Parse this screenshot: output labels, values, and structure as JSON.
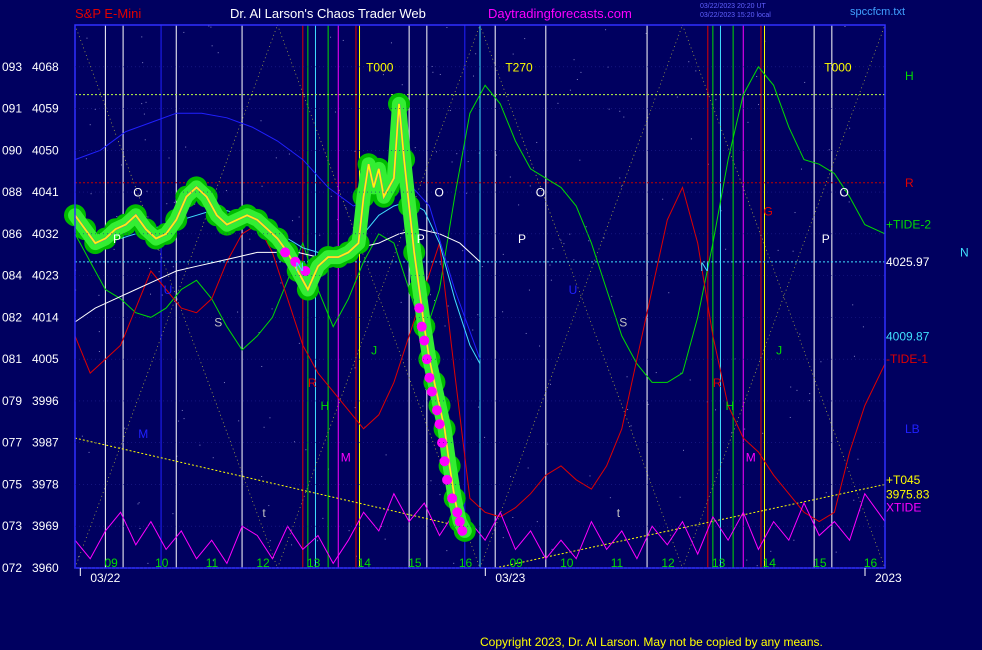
{
  "header": {
    "title_left": "S&P E-Mini",
    "title_center": "Dr. Al Larson's Chaos Trader Web",
    "site": "Daytradingforecasts.com",
    "stamp_line1": "03/22/2023 20:20 UT",
    "stamp_line2": "03/22/2023 15:20 local",
    "filename": "spccfcm.txt"
  },
  "footer": {
    "copyright": "Copyright 2023, Dr. Al Larson. May not be copied by any means."
  },
  "colors": {
    "background": "#000060",
    "price_green": "#00cc00",
    "price_magenta": "#ff00ff",
    "price_yellow": "#ffff00",
    "tide2": "#00dd00",
    "tide1": "#e00000",
    "xtide": "#ff00ff",
    "cyan_ma": "#40e0ff",
    "white_ma": "#ffffff",
    "blue_ma": "#2020ff",
    "axis": "#3030ff"
  },
  "chart_data": {
    "type": "line",
    "title": "S&P E-Mini",
    "ylim": [
      3960,
      4077
    ],
    "y_ticks": [
      {
        "left": "072",
        "price": 3960
      },
      {
        "left": "073",
        "price": 3969
      },
      {
        "left": "075",
        "price": 3978
      },
      {
        "left": "077",
        "price": 3987
      },
      {
        "left": "079",
        "price": 3996
      },
      {
        "left": "081",
        "price": 4005
      },
      {
        "left": "082",
        "price": 4014
      },
      {
        "left": "084",
        "price": 4023
      },
      {
        "left": "086",
        "price": 4032
      },
      {
        "left": "088",
        "price": 4041
      },
      {
        "left": "090",
        "price": 4050
      },
      {
        "left": "091",
        "price": 4059
      },
      {
        "left": "093",
        "price": 4068
      }
    ],
    "x_hour_ticks": [
      {
        "label": "09",
        "t": 0.7
      },
      {
        "label": "10",
        "t": 1.7
      },
      {
        "label": "11",
        "t": 2.7
      },
      {
        "label": "12",
        "t": 3.7
      },
      {
        "label": "13",
        "t": 4.7
      },
      {
        "label": "14",
        "t": 5.7
      },
      {
        "label": "15",
        "t": 6.7
      },
      {
        "label": "16",
        "t": 7.7
      },
      {
        "label": "09",
        "t": 8.7
      },
      {
        "label": "10",
        "t": 9.7
      },
      {
        "label": "11",
        "t": 10.7
      },
      {
        "label": "12",
        "t": 11.7
      },
      {
        "label": "13",
        "t": 12.7
      },
      {
        "label": "14",
        "t": 13.7
      },
      {
        "label": "15",
        "t": 14.7
      },
      {
        "label": "16",
        "t": 15.7
      }
    ],
    "x_date_labels": [
      {
        "label": "03/22",
        "t": 0.5
      },
      {
        "label": "03/23",
        "t": 8.5
      },
      {
        "label": "2023",
        "t": 16.0
      }
    ],
    "xlim": [
      0,
      16.0
    ],
    "right_labels": [
      {
        "text": "H",
        "price": 4066,
        "color": "#00dd00"
      },
      {
        "text": "R",
        "price": 4043,
        "color": "#e00000"
      },
      {
        "text": "+TIDE-2",
        "price": 4034,
        "color": "#00dd00"
      },
      {
        "text": "4025.97",
        "price": 4025.97,
        "color": "#ffffff"
      },
      {
        "text": "N",
        "price": 4028,
        "color": "#40e0ff"
      },
      {
        "text": "4009.87",
        "price": 4009.87,
        "color": "#40e0ff"
      },
      {
        "text": "-TIDE-1",
        "price": 4005,
        "color": "#e00000"
      },
      {
        "text": "LB",
        "price": 3990,
        "color": "#2020ff"
      },
      {
        "text": "+T045",
        "price": 3979,
        "color": "#ffff00"
      },
      {
        "text": "3975.83",
        "price": 3975.83,
        "color": "#ffff00"
      },
      {
        "text": "XTIDE",
        "price": 3973,
        "color": "#ff00ff"
      }
    ],
    "chart_labels": [
      {
        "text": "T000",
        "t": 5.75,
        "price": 4067,
        "color": "#ffff00"
      },
      {
        "text": "T270",
        "t": 8.5,
        "price": 4067,
        "color": "#ffff00"
      },
      {
        "text": "T000",
        "t": 14.8,
        "price": 4067,
        "color": "#ffff00"
      },
      {
        "text": "O",
        "t": 1.15,
        "price": 4040,
        "color": "#ffffff"
      },
      {
        "text": "O",
        "t": 7.1,
        "price": 4040,
        "color": "#ffffff"
      },
      {
        "text": "O",
        "t": 9.1,
        "price": 4040,
        "color": "#ffffff"
      },
      {
        "text": "O",
        "t": 15.1,
        "price": 4040,
        "color": "#ffffff"
      },
      {
        "text": "P",
        "t": 0.75,
        "price": 4030,
        "color": "#ffffff"
      },
      {
        "text": "P",
        "t": 6.75,
        "price": 4030,
        "color": "#ffffff"
      },
      {
        "text": "P",
        "t": 8.75,
        "price": 4030,
        "color": "#ffffff"
      },
      {
        "text": "P",
        "t": 14.75,
        "price": 4030,
        "color": "#ffffff"
      },
      {
        "text": "N",
        "t": 4.35,
        "price": 4024,
        "color": "#40e0ff"
      },
      {
        "text": "N",
        "t": 12.35,
        "price": 4024,
        "color": "#40e0ff"
      },
      {
        "text": "U",
        "t": 1.75,
        "price": 4019,
        "color": "#2020ff"
      },
      {
        "text": "U",
        "t": 9.75,
        "price": 4019,
        "color": "#2020ff"
      },
      {
        "text": "S",
        "t": 2.75,
        "price": 4012,
        "color": "#c0c0c0"
      },
      {
        "text": "S",
        "t": 10.75,
        "price": 4012,
        "color": "#c0c0c0"
      },
      {
        "text": "J",
        "t": 5.85,
        "price": 4006,
        "color": "#00dd00"
      },
      {
        "text": "J",
        "t": 13.85,
        "price": 4006,
        "color": "#00dd00"
      },
      {
        "text": "R",
        "t": 4.6,
        "price": 3999,
        "color": "#e00000"
      },
      {
        "text": "R",
        "t": 12.6,
        "price": 3999,
        "color": "#e00000"
      },
      {
        "text": "H",
        "t": 4.85,
        "price": 3994,
        "color": "#00dd00"
      },
      {
        "text": "H",
        "t": 12.85,
        "price": 3994,
        "color": "#00dd00"
      },
      {
        "text": "M",
        "t": 1.25,
        "price": 3988,
        "color": "#2020ff"
      },
      {
        "text": "M",
        "t": 5.25,
        "price": 3983,
        "color": "#ff00ff"
      },
      {
        "text": "M",
        "t": 13.25,
        "price": 3983,
        "color": "#ff00ff"
      },
      {
        "text": "t",
        "t": 3.7,
        "price": 3971,
        "color": "#c0c0c0"
      },
      {
        "text": "t",
        "t": 10.7,
        "price": 3971,
        "color": "#c0c0c0"
      },
      {
        "text": "G",
        "t": 13.6,
        "price": 4036,
        "color": "#e00000"
      }
    ],
    "vertical_lines": [
      {
        "t": 0.6,
        "color": "#ffffff"
      },
      {
        "t": 0.95,
        "color": "#ffffff"
      },
      {
        "t": 1.7,
        "color": "#2020ff"
      },
      {
        "t": 2.0,
        "color": "#ffffff"
      },
      {
        "t": 3.3,
        "color": "#ffffff"
      },
      {
        "t": 4.5,
        "color": "#e00000"
      },
      {
        "t": 4.6,
        "color": "#00dd00"
      },
      {
        "t": 4.75,
        "color": "#40e0ff"
      },
      {
        "t": 5.0,
        "color": "#00dd00"
      },
      {
        "t": 5.2,
        "color": "#ff00ff"
      },
      {
        "t": 5.55,
        "color": "#e00000"
      },
      {
        "t": 5.62,
        "color": "#ffff00"
      },
      {
        "t": 6.6,
        "color": "#ffffff"
      },
      {
        "t": 6.95,
        "color": "#ffffff"
      },
      {
        "t": 7.7,
        "color": "#2020ff"
      },
      {
        "t": 8.0,
        "color": "#40e0ff"
      },
      {
        "t": 8.3,
        "color": "#ffffff"
      },
      {
        "t": 9.3,
        "color": "#ffffff"
      },
      {
        "t": 11.3,
        "color": "#ffffff"
      },
      {
        "t": 12.5,
        "color": "#e00000"
      },
      {
        "t": 12.6,
        "color": "#00dd00"
      },
      {
        "t": 12.75,
        "color": "#40e0ff"
      },
      {
        "t": 13.0,
        "color": "#00dd00"
      },
      {
        "t": 13.2,
        "color": "#ff00ff"
      },
      {
        "t": 13.55,
        "color": "#e00000"
      },
      {
        "t": 13.62,
        "color": "#ffff00"
      },
      {
        "t": 14.6,
        "color": "#ffffff"
      },
      {
        "t": 14.95,
        "color": "#ffffff"
      }
    ],
    "horizontal_levels": [
      {
        "price": 4062,
        "color": "#c0ff40"
      },
      {
        "price": 4043,
        "color": "#c00000"
      },
      {
        "price": 4025.97,
        "color": "#40e0ff"
      }
    ],
    "series": [
      {
        "name": "price",
        "color": "#ffff00",
        "x": [
          0,
          0.2,
          0.4,
          0.6,
          0.8,
          1.0,
          1.2,
          1.4,
          1.6,
          1.8,
          2.0,
          2.2,
          2.4,
          2.6,
          2.8,
          3.0,
          3.2,
          3.4,
          3.6,
          3.8,
          4.0,
          4.2,
          4.4,
          4.6,
          4.8,
          5.0,
          5.2,
          5.4,
          5.6,
          5.7,
          5.8,
          5.9,
          6.0,
          6.1,
          6.2,
          6.3,
          6.4,
          6.5,
          6.6,
          6.7,
          6.8,
          6.9,
          7.0,
          7.1,
          7.2,
          7.3,
          7.4,
          7.5,
          7.6,
          7.7
        ],
        "y": [
          4036,
          4033,
          4030,
          4031,
          4033,
          4034,
          4036,
          4033,
          4031,
          4032,
          4035,
          4040,
          4042,
          4040,
          4036,
          4034,
          4035,
          4036,
          4035,
          4033,
          4031,
          4028,
          4024,
          4020,
          4025,
          4027,
          4027,
          4028,
          4030,
          4040,
          4047,
          4042,
          4046,
          4040,
          4042,
          4044,
          4060,
          4048,
          4038,
          4028,
          4020,
          4012,
          4005,
          4000,
          3995,
          3990,
          3982,
          3975,
          3970,
          3968
        ]
      },
      {
        "name": "+TIDE-2",
        "color": "#00dd00",
        "x": [
          0,
          0.3,
          0.6,
          0.9,
          1.2,
          1.5,
          1.8,
          2.1,
          2.4,
          2.7,
          3.0,
          3.3,
          3.6,
          3.9,
          4.2,
          4.5,
          4.8,
          5.1,
          5.4,
          5.7,
          6.0,
          6.3,
          6.6,
          6.9,
          7.2,
          7.5,
          7.8,
          8.1,
          8.4,
          8.7,
          9.0,
          9.3,
          9.6,
          9.9,
          10.2,
          10.5,
          10.8,
          11.1,
          11.4,
          11.7,
          12.0,
          12.3,
          12.6,
          12.9,
          13.2,
          13.5,
          13.8,
          14.1,
          14.4,
          14.7,
          15.0,
          15.3,
          15.6,
          16.0
        ],
        "y": [
          4032,
          4026,
          4020,
          4018,
          4015,
          4014,
          4016,
          4020,
          4022,
          4018,
          4012,
          4007,
          4010,
          4014,
          4022,
          4030,
          4020,
          4012,
          4018,
          4026,
          4032,
          4030,
          4020,
          4010,
          4020,
          4040,
          4058,
          4064,
          4060,
          4052,
          4046,
          4044,
          4042,
          4038,
          4030,
          4020,
          4010,
          4004,
          4000,
          4000,
          4002,
          4014,
          4030,
          4048,
          4062,
          4068,
          4064,
          4055,
          4048,
          4047,
          4045,
          4040,
          4034,
          4032
        ]
      },
      {
        "name": "-TIDE-1",
        "color": "#e00000",
        "x": [
          0,
          0.3,
          0.6,
          0.9,
          1.2,
          1.5,
          1.8,
          2.1,
          2.4,
          2.7,
          3.0,
          3.3,
          3.6,
          3.9,
          4.2,
          4.5,
          4.8,
          5.1,
          5.4,
          5.7,
          6.0,
          6.3,
          6.6,
          6.9,
          7.2,
          7.5,
          7.8,
          8.1,
          8.4,
          8.7,
          9.0,
          9.3,
          9.6,
          9.9,
          10.2,
          10.5,
          10.8,
          11.1,
          11.4,
          11.7,
          12.0,
          12.3,
          12.6,
          12.9,
          13.2,
          13.5,
          13.8,
          14.1,
          14.4,
          14.7,
          15.0,
          15.3,
          15.6,
          16.0
        ],
        "y": [
          4010,
          4002,
          4005,
          4008,
          4016,
          4024,
          4020,
          4016,
          4015,
          4018,
          4026,
          4032,
          4034,
          4028,
          4018,
          4008,
          4002,
          3998,
          3994,
          3990,
          3993,
          4000,
          4010,
          4020,
          4030,
          4002,
          3975,
          3972,
          3971,
          3973,
          3976,
          3980,
          3982,
          3979,
          3977,
          3982,
          3990,
          4005,
          4020,
          4035,
          4042,
          4030,
          4010,
          3995,
          3988,
          3985,
          3980,
          3976,
          3972,
          3970,
          3972,
          3985,
          3995,
          4004
        ]
      },
      {
        "name": "cyan",
        "color": "#40e0ff",
        "x": [
          0,
          0.3,
          0.6,
          0.9,
          1.2,
          1.5,
          1.8,
          2.1,
          2.4,
          2.7,
          3.0,
          3.3,
          3.6,
          3.9,
          4.2,
          4.5,
          4.8,
          5.1,
          5.4,
          5.7,
          6.0,
          6.3,
          6.6,
          6.9,
          7.2,
          7.5,
          7.8,
          8.0
        ],
        "y": [
          4032,
          4031,
          4030,
          4031,
          4032,
          4033,
          4034,
          4035,
          4036,
          4037,
          4037,
          4036,
          4035,
          4033,
          4031,
          4029,
          4028,
          4028,
          4029,
          4032,
          4036,
          4038,
          4039,
          4037,
          4030,
          4018,
          4008,
          4004
        ]
      },
      {
        "name": "white",
        "color": "#ffffff",
        "x": [
          0,
          0.4,
          0.8,
          1.2,
          1.6,
          2.0,
          2.4,
          2.8,
          3.2,
          3.6,
          4.0,
          4.4,
          4.8,
          5.2,
          5.6,
          6.0,
          6.4,
          6.8,
          7.2,
          7.6,
          8.0
        ],
        "y": [
          4013,
          4016,
          4018,
          4020,
          4022,
          4024,
          4025,
          4026,
          4027,
          4028,
          4028,
          4028,
          4027,
          4028,
          4029,
          4030,
          4032,
          4033,
          4032,
          4030,
          4026
        ]
      },
      {
        "name": "LB",
        "color": "#2020ff",
        "x": [
          0,
          0.5,
          1.0,
          1.5,
          2.0,
          2.5,
          3.0,
          3.5,
          4.0,
          4.5,
          5.0,
          5.5,
          6.0,
          6.5,
          7.0,
          7.5,
          8.0
        ],
        "y": [
          4048,
          4050,
          4054,
          4056,
          4058,
          4058,
          4057,
          4055,
          4052,
          4048,
          4042,
          4038,
          4040,
          4044,
          4038,
          4020,
          4005
        ]
      },
      {
        "name": "XTIDE",
        "color": "#ff00ff",
        "x": [
          0,
          0.3,
          0.6,
          0.9,
          1.2,
          1.5,
          1.8,
          2.1,
          2.4,
          2.7,
          3.0,
          3.3,
          3.6,
          3.9,
          4.2,
          4.5,
          4.8,
          5.1,
          5.4,
          5.7,
          6.0,
          6.3,
          6.6,
          6.9,
          7.2,
          7.5,
          7.8,
          8.1,
          8.4,
          8.7,
          9.0,
          9.3,
          9.6,
          9.9,
          10.2,
          10.5,
          10.8,
          11.1,
          11.4,
          11.7,
          12.0,
          12.3,
          12.6,
          12.9,
          13.2,
          13.5,
          13.8,
          14.1,
          14.4,
          14.7,
          15.0,
          15.3,
          15.6,
          16.0
        ],
        "y": [
          3966,
          3962,
          3968,
          3972,
          3965,
          3970,
          3964,
          3968,
          3962,
          3966,
          3961,
          3969,
          3967,
          3962,
          3969,
          3964,
          3967,
          3961,
          3966,
          3972,
          3968,
          3976,
          3970,
          3974,
          3967,
          3972,
          3970,
          3966,
          3972,
          3964,
          3968,
          3962,
          3966,
          3962,
          3970,
          3964,
          3968,
          3962,
          3969,
          3965,
          3970,
          3963,
          3971,
          3966,
          3972,
          3964,
          3970,
          3966,
          3974,
          3967,
          3970,
          3966,
          3976,
          3970
        ]
      }
    ],
    "trend_lines": [
      {
        "color": "#ffff00",
        "points": [
          [
            0,
            3988
          ],
          [
            7.6,
            3969
          ]
        ]
      },
      {
        "color": "#ffff00",
        "points": [
          [
            8.3,
            3960
          ],
          [
            16.0,
            3978
          ]
        ]
      }
    ],
    "magenta_dots": {
      "x": [
        4.15,
        4.35,
        4.55,
        6.8,
        6.85,
        6.9,
        6.95,
        7.0,
        7.05,
        7.15,
        7.2,
        7.25,
        7.3,
        7.35,
        7.45,
        7.55,
        7.6,
        7.65
      ],
      "y": [
        4028,
        4026,
        4024,
        4016,
        4012,
        4009,
        4005,
        4001,
        3998,
        3994,
        3991,
        3987,
        3983,
        3979,
        3975,
        3972,
        3970,
        3968
      ]
    }
  }
}
